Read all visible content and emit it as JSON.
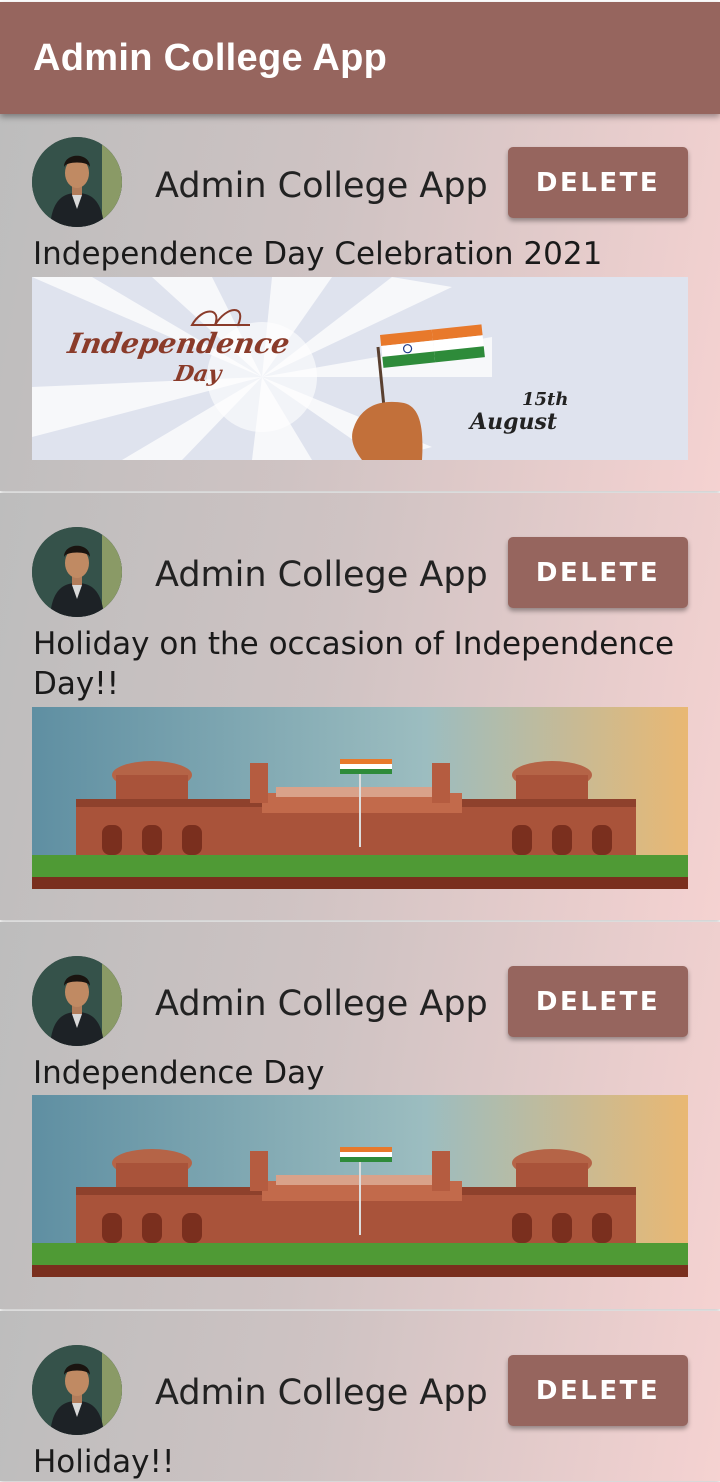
{
  "app_bar": {
    "title": "Admin College App"
  },
  "posts": [
    {
      "author": "Admin College App",
      "delete_label": "DELETE",
      "text": "Independence Day Celebration 2021",
      "image": "independence-day-banner",
      "banner": {
        "line1": "Independence",
        "line2": "Day",
        "date_num": "15th",
        "date_month": "August"
      }
    },
    {
      "author": "Admin College App",
      "delete_label": "DELETE",
      "text": "Holiday on the occasion of Independence Day!!",
      "image": "red-fort-photo"
    },
    {
      "author": "Admin College App",
      "delete_label": "DELETE",
      "text": "Independence Day",
      "image": "red-fort-photo"
    },
    {
      "author": "Admin College App",
      "delete_label": "DELETE",
      "text": "Holiday!!",
      "image": ""
    }
  ],
  "colors": {
    "accent": "#96655e",
    "card_left": "#bdbdbd",
    "card_right": "#f5d2d1"
  }
}
